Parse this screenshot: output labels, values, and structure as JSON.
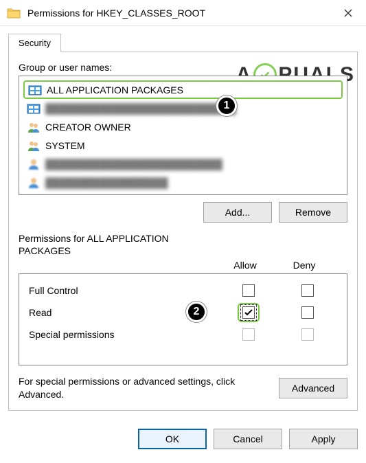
{
  "window": {
    "title": "Permissions for HKEY_CLASSES_ROOT"
  },
  "tab": {
    "label": "Security"
  },
  "group": {
    "label": "Group or user names:",
    "items": [
      {
        "label": "ALL APPLICATION PACKAGES",
        "icon": "package",
        "highlighted": true
      },
      {
        "label": "████████████████████████████",
        "icon": "package",
        "blurred": true
      },
      {
        "label": "CREATOR OWNER",
        "icon": "users"
      },
      {
        "label": "SYSTEM",
        "icon": "users"
      },
      {
        "label": "██████████████████████████",
        "icon": "user",
        "blurred": true
      },
      {
        "label": "██████████████████",
        "icon": "user",
        "blurred": true
      }
    ]
  },
  "buttons": {
    "add": "Add...",
    "remove": "Remove",
    "advanced": "Advanced",
    "ok": "OK",
    "cancel": "Cancel",
    "apply": "Apply"
  },
  "permissions": {
    "header": "Permissions for ALL APPLICATION PACKAGES",
    "col_allow": "Allow",
    "col_deny": "Deny",
    "rows": [
      {
        "name": "Full Control",
        "allow": false,
        "deny": false
      },
      {
        "name": "Read",
        "allow": true,
        "deny": false,
        "highlight_allow": true
      },
      {
        "name": "Special permissions",
        "allow": false,
        "deny": false,
        "dim": true
      }
    ]
  },
  "note": "For special permissions or advanced settings, click Advanced.",
  "annotations": {
    "callout1": "1",
    "callout2": "2"
  },
  "watermark": {
    "pre": "A",
    "post": "PUALS"
  }
}
